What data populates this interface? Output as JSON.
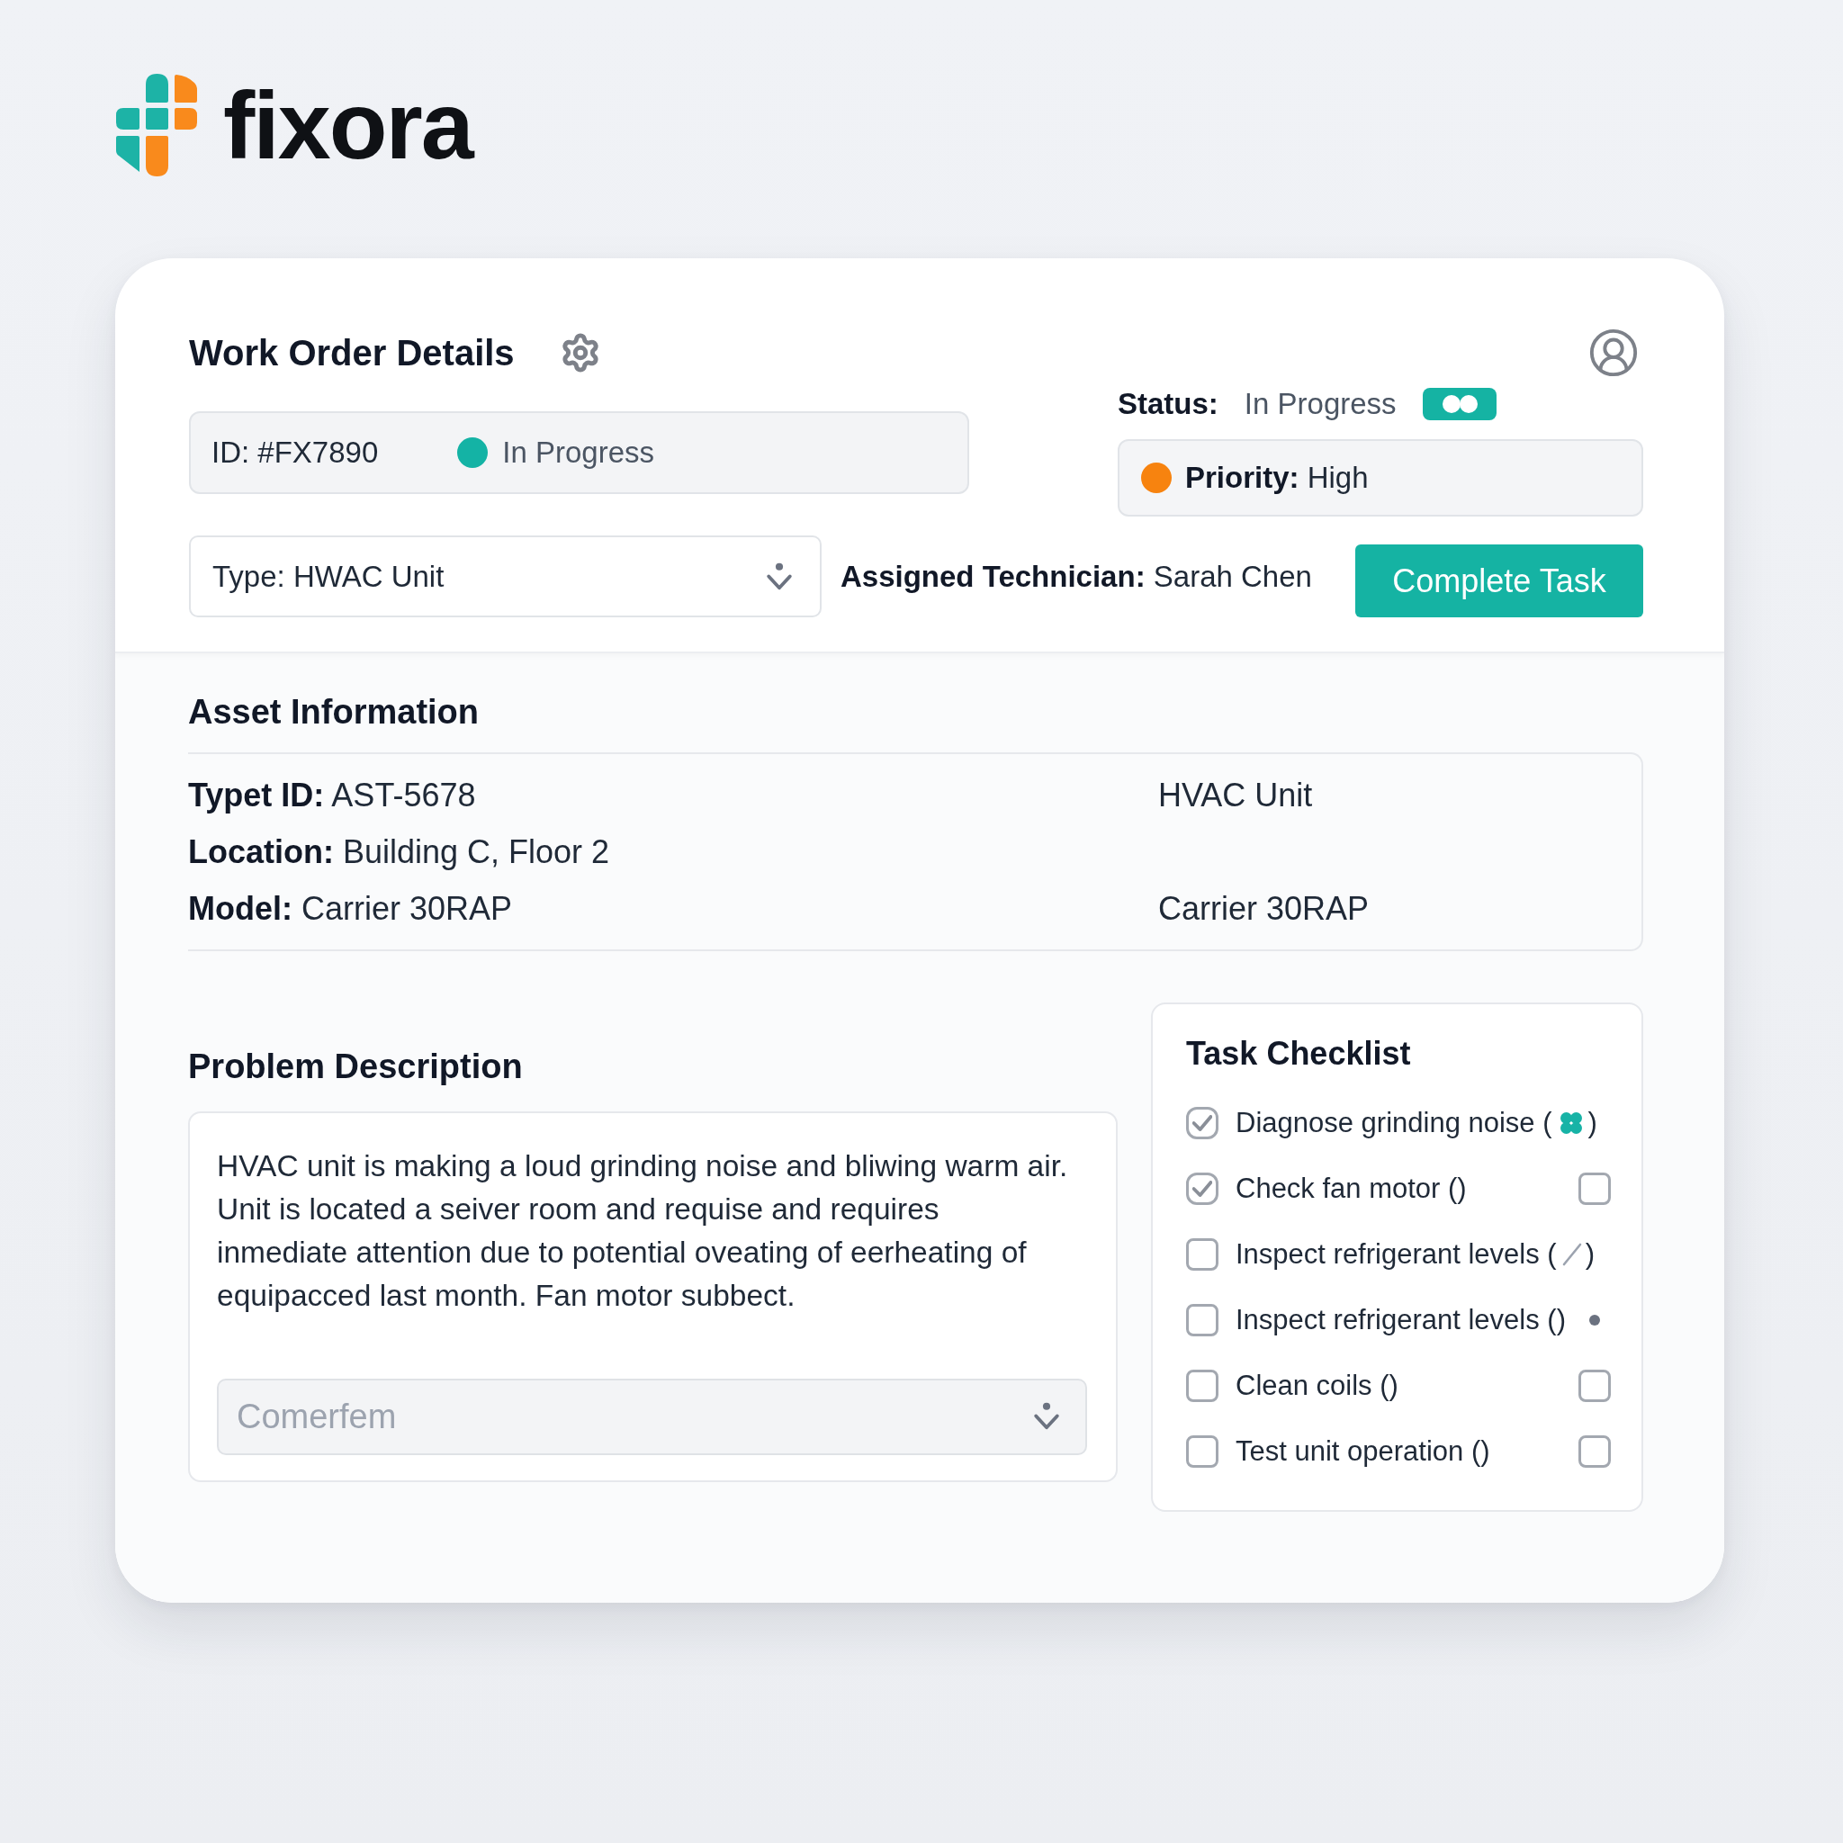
{
  "brand": {
    "name": "fixora"
  },
  "header": {
    "title": "Work Order Details",
    "id_bar": {
      "id": "ID: #FX7890",
      "status": "In Progress",
      "color": "#14b3a5"
    },
    "status": {
      "label": "Status:",
      "value": "In Progress"
    },
    "priority": {
      "text": "**Priority:** High",
      "color": "#f7830f"
    },
    "type_select": {
      "value": "Type: HWAC Unit"
    },
    "technician": "**Assigned Technician:** Sarah Chen",
    "complete_button": "Complete Task"
  },
  "asset_info": {
    "title": "Asset Information",
    "rows": [
      {
        "left": "**Typet ID:** AST-5678",
        "right": "HVAC Unit"
      },
      {
        "left": "**Location:** Building C, Floor 2"
      },
      {
        "left": "**Model:** Carrier 30RAP",
        "right": "Carrier 30RAP"
      }
    ]
  },
  "problem": {
    "title": "Problem Description",
    "text": "HVAC unit is making a loud grinding noise and bliwing warm air.\nUnit is located a seiver room and requise and requires\ninmediate attention due to potential oveating of eerheating of\nequipacced last month. Fan motor subbect.",
    "comment": {
      "placeholder": "Comerfem"
    }
  },
  "checklist": {
    "title": "Task Checklist",
    "items": [
      {
        "label": "Diagnose grinding noise (",
        "checked": true,
        "kind": "clover",
        "close": ")"
      },
      {
        "label": "Check fan motor ()",
        "checked": true,
        "kind": "checkbox",
        "side_checked": false
      },
      {
        "label": "Inspect refrigerant levels (",
        "checked": false,
        "kind": "slash",
        "close": ")"
      },
      {
        "label": "Inspect refrigerant levels ()",
        "checked": false,
        "kind": "dot"
      },
      {
        "label": "Clean coils ()",
        "checked": false,
        "kind": "checkbox",
        "side_checked": false
      },
      {
        "label": "Test unit operation ()",
        "checked": false,
        "kind": "checkbox",
        "side_checked": false
      }
    ]
  }
}
